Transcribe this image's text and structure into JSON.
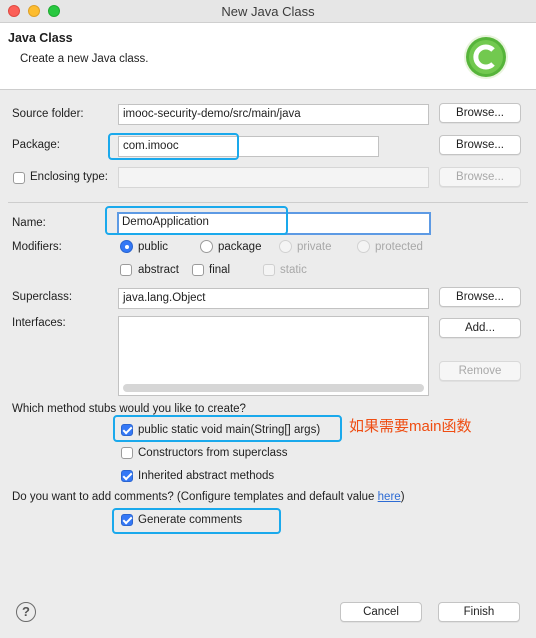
{
  "window": {
    "title": "New Java Class"
  },
  "header": {
    "title": "Java Class",
    "description": "Create a new Java class."
  },
  "source_folder": {
    "label": "Source folder:",
    "value": "imooc-security-demo/src/main/java",
    "browse": "Browse..."
  },
  "package": {
    "label": "Package:",
    "value": "com.imooc",
    "browse": "Browse..."
  },
  "enclosing": {
    "label": "Enclosing type:",
    "value": "",
    "browse": "Browse..."
  },
  "name": {
    "label": "Name:",
    "value": "DemoApplication"
  },
  "modifiers": {
    "label": "Modifiers:",
    "access": [
      "public",
      "package",
      "private",
      "protected"
    ],
    "selected": "public",
    "flags": [
      "abstract",
      "final",
      "static"
    ]
  },
  "superclass": {
    "label": "Superclass:",
    "value": "java.lang.Object",
    "browse": "Browse..."
  },
  "interfaces": {
    "label": "Interfaces:",
    "add": "Add...",
    "remove": "Remove"
  },
  "stubs": {
    "question": "Which method stubs would you like to create?",
    "items": [
      {
        "label": "public static void main(String[] args)",
        "checked": true
      },
      {
        "label": "Constructors from superclass",
        "checked": false
      },
      {
        "label": "Inherited abstract methods",
        "checked": true
      }
    ]
  },
  "annotation": "如果需要main函数",
  "comments": {
    "question": "Do you want to add comments? (Configure templates and default value ",
    "link": "here",
    "question_end": ")",
    "generate": "Generate comments",
    "generate_checked": true
  },
  "footer": {
    "cancel": "Cancel",
    "finish": "Finish"
  },
  "colors": {
    "accent": "#3478f6",
    "highlight": "#1aa9ec",
    "annotation": "#ef4d12"
  }
}
